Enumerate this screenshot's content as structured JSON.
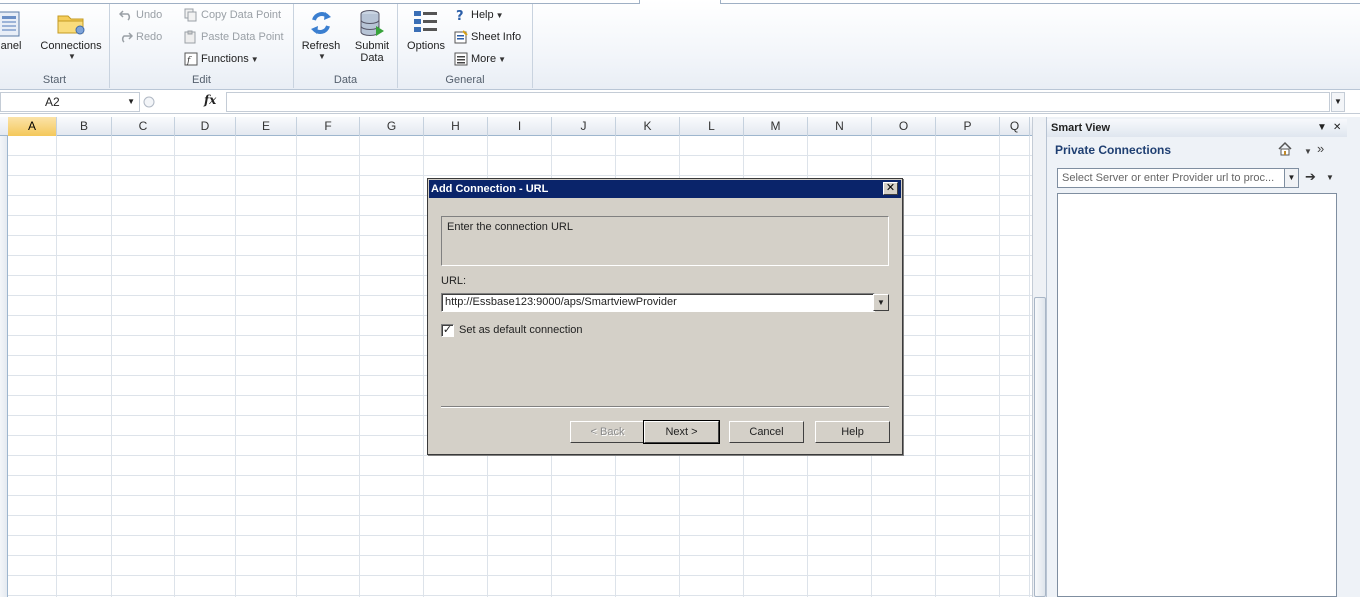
{
  "ribbon": {
    "start": {
      "label": "Start",
      "panel_label": "anel",
      "connections_label": "Connections"
    },
    "edit": {
      "label": "Edit",
      "undo": "Undo",
      "redo": "Redo",
      "copy_data_point": "Copy Data Point",
      "paste_data_point": "Paste Data Point",
      "functions": "Functions"
    },
    "data": {
      "label": "Data",
      "refresh": "Refresh",
      "submit_line1": "Submit",
      "submit_line2": "Data"
    },
    "general": {
      "label": "General",
      "options": "Options",
      "help": "Help",
      "sheet_info": "Sheet Info",
      "more": "More"
    }
  },
  "formula_bar": {
    "name_box": "A2",
    "fx": "fx",
    "value": ""
  },
  "grid": {
    "columns": [
      "A",
      "B",
      "C",
      "D",
      "E",
      "F",
      "G",
      "H",
      "I",
      "J",
      "K",
      "L",
      "M",
      "N",
      "O",
      "P",
      "Q"
    ],
    "selected_column": "A"
  },
  "smart_view": {
    "title": "Smart View",
    "subtitle": "Private Connections",
    "combo_placeholder": "Select Server or enter Provider url to proc..."
  },
  "dialog": {
    "title": "Add Connection - URL",
    "info_text": "Enter the connection URL",
    "url_label": "URL:",
    "url_value": "http://Essbase123:9000/aps/SmartviewProvider",
    "default_checkbox_label": "Set as default connection",
    "default_checked": true,
    "buttons": {
      "back": "< Back",
      "next": "Next >",
      "cancel": "Cancel",
      "help": "Help"
    }
  },
  "colors": {
    "dialog_title_bg": "#0a246a",
    "dialog_bg": "#d4d0c8",
    "selected_header": "#f4c85b",
    "smartview_subtitle": "#1f3f72"
  }
}
